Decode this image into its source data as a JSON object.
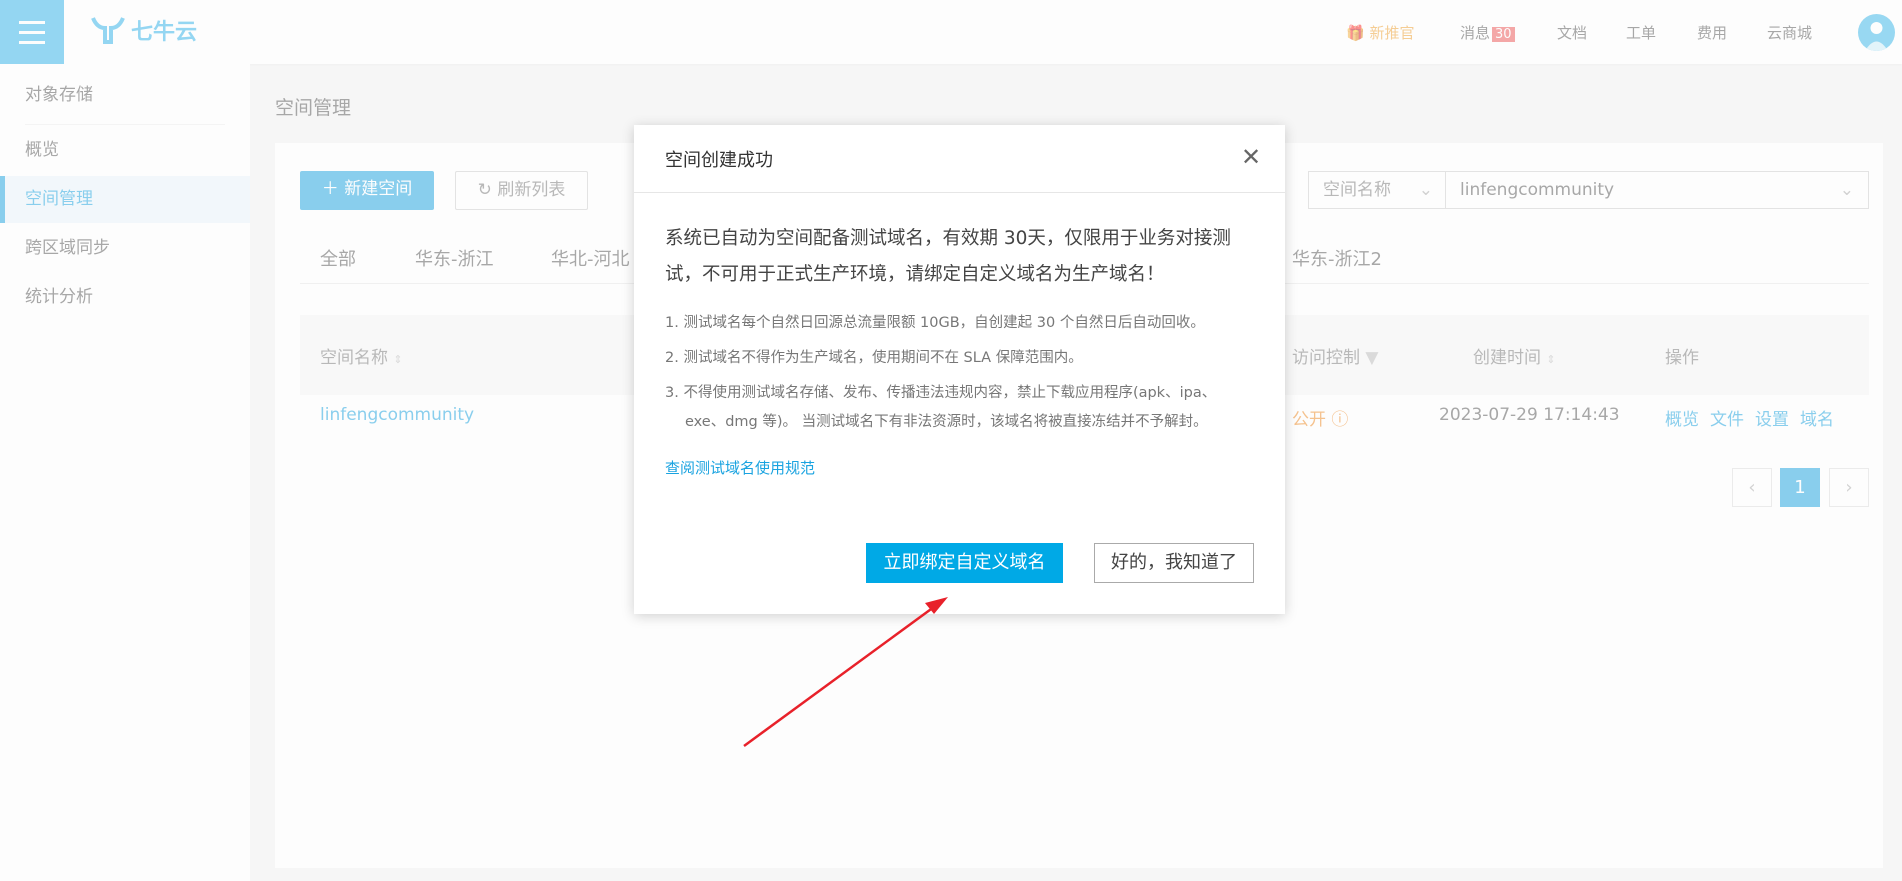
{
  "topbar": {
    "logo_text": "七牛云",
    "nav": [
      {
        "label": "新推官",
        "icon": "gift-icon"
      },
      {
        "label": "消息",
        "badge": "30"
      },
      {
        "label": "文档"
      },
      {
        "label": "工单"
      },
      {
        "label": "费用"
      },
      {
        "label": "云商城"
      }
    ]
  },
  "sidebar": {
    "section": "对象存储",
    "items": [
      "概览",
      "空间管理",
      "跨区域同步",
      "统计分析"
    ],
    "active": "空间管理"
  },
  "page": {
    "title": "空间管理",
    "new_button": "新建空间",
    "refresh_button": "刷新列表",
    "search": {
      "field": "空间名称",
      "value": "linfengcommunity"
    },
    "tabs": [
      "全部",
      "华东-浙江",
      "华北-河北",
      "华东-浙江2"
    ],
    "table": {
      "headers": [
        "空间名称",
        "访问控制",
        "创建时间",
        "操作"
      ],
      "rows": [
        {
          "name": "linfengcommunity",
          "access": "公开",
          "created": "2023-07-29 17:14:43",
          "actions": [
            "概览",
            "文件",
            "设置",
            "域名"
          ]
        }
      ]
    },
    "pagination": {
      "current": "1",
      "prev": "‹",
      "next": "›"
    }
  },
  "modal": {
    "title": "空间创建成功",
    "close": "✕",
    "message": "系统已自动为空间配备测试域名，有效期 30天，仅限用于业务对接测试，不可用于正式生产环境，请绑定自定义域名为生产域名！",
    "notes": [
      "1. 测试域名每个自然日回源总流量限额  10GB，自创建起  30  个自然日后自动回收。",
      "2. 测试域名不得作为生产域名，使用期间不在 SLA 保障范围内。",
      "3. 不得使用测试域名存储、发布、传播违法违规内容，禁止下载应用程序(apk、ipa、exe、dmg 等)。 当测试域名下有非法资源时，该域名将被直接冻结并不予解封。"
    ],
    "link": "查阅测试域名使用规范",
    "primary_button": "立即绑定自定义域名",
    "secondary_button": "好的，我知道了"
  },
  "colors": {
    "primary": "#00a9e6",
    "annotation_arrow": "#e8212a",
    "warning": "#f08a24"
  }
}
